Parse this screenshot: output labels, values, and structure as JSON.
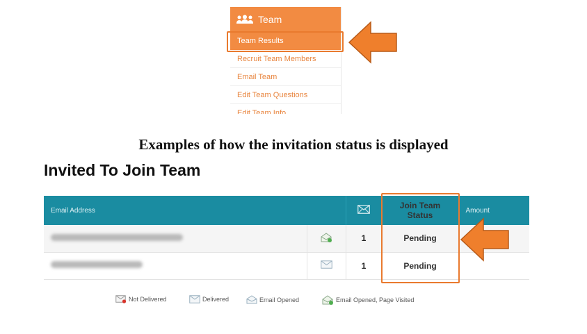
{
  "menu": {
    "title": "Team",
    "items": [
      {
        "label": "Team Results",
        "active": true
      },
      {
        "label": "Recruit Team Members",
        "active": false
      },
      {
        "label": "Email Team",
        "active": false
      },
      {
        "label": "Edit Team Questions",
        "active": false
      },
      {
        "label": "Edit Team Info",
        "active": false
      }
    ],
    "header_icon": "team-icon"
  },
  "caption": "Examples of how the invitation status is displayed",
  "section_title": "Invited To Join Team",
  "table": {
    "columns": {
      "email": "Email Address",
      "sent_icon": "envelope-icon",
      "status": "Join Team Status",
      "amount": "Amount"
    },
    "rows": [
      {
        "email_icon": "email-opened-page-visited-icon",
        "sent": "1",
        "status": "Pending"
      },
      {
        "email_icon": "delivered-icon",
        "sent": "1",
        "status": "Pending"
      }
    ]
  },
  "legend": [
    {
      "label": "Not Delivered",
      "icon": "not-delivered-icon"
    },
    {
      "label": "Delivered",
      "icon": "delivered-icon"
    },
    {
      "label": "Email Opened",
      "icon": "email-opened-icon"
    },
    {
      "label": "Email Opened, Page Visited",
      "icon": "email-opened-page-visited-icon"
    }
  ],
  "colors": {
    "accent_orange": "#f28b42",
    "arrow_orange": "#ef7f2c",
    "table_header_teal": "#1a8ca1"
  }
}
